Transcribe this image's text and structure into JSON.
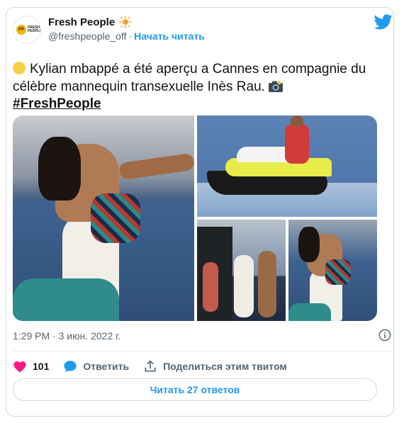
{
  "author": {
    "name": "Fresh People",
    "handle": "@freshpeople_off",
    "follow_label": "Начать читать",
    "avatar_badge": "FP",
    "avatar_text": "FRESH PEOPLE"
  },
  "tweet": {
    "text": "Kylian mbappé a été aperçu a Cannes en compagnie du célèbre mannequin transexuelle Inès Rau.",
    "hashtag": "#FreshPeople",
    "timestamp": "1:29 PM · 3 июн. 2022 г."
  },
  "actions": {
    "like_count": "101",
    "reply_label": "Ответить",
    "share_label": "Поделиться этим твитом"
  },
  "replies_button": "Читать 27 ответов",
  "colors": {
    "accent": "#1d9bf0",
    "like": "#f91880",
    "text": "#0f1419",
    "muted": "#536471",
    "border": "#cfd9de"
  },
  "icons": [
    "twitter-logo-icon",
    "sun-emoji-icon",
    "circle-emoji-icon",
    "camera-emoji-icon",
    "info-icon",
    "heart-icon",
    "reply-bubble-icon",
    "share-icon"
  ]
}
